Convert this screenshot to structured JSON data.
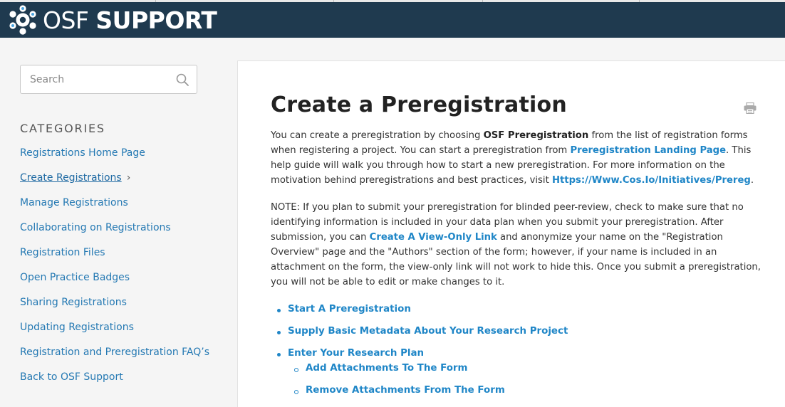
{
  "header": {
    "logo_osf": "OSF",
    "logo_support": "SUPPORT"
  },
  "sidebar": {
    "search_placeholder": "Search",
    "categories_title": "CATEGORIES",
    "items": [
      {
        "label": "Registrations Home Page"
      },
      {
        "label": "Create Registrations",
        "active": true
      },
      {
        "label": "Manage Registrations"
      },
      {
        "label": "Collaborating on Registrations"
      },
      {
        "label": "Registration Files"
      },
      {
        "label": "Open Practice Badges"
      },
      {
        "label": "Sharing Registrations"
      },
      {
        "label": "Updating Registrations"
      },
      {
        "label": "Registration and Preregistration FAQ’s"
      },
      {
        "label": "Back to OSF Support"
      }
    ]
  },
  "article": {
    "title": "Create a Preregistration",
    "p1": {
      "t1": "You can create a preregistration by choosing ",
      "b1": "OSF Preregistration",
      "t2": " from the list of registration forms when registering a project. You can start a preregistration from ",
      "link1": "Preregistration Landing Page",
      "t3": ". This help guide will walk you through how to start a new preregistration. For more information on the motivation behind preregistrations and best practices, visit ",
      "link2": "Https://Www.Cos.Io/Initiatives/Prereg",
      "t4": "."
    },
    "p2": {
      "t1": "NOTE: If you plan to submit your preregistration for blinded peer-review, check to make sure that no identifying information is included in your data plan when you submit your preregistration. After submission, you can ",
      "link1": "Create A View-Only Link",
      "t2": " and anonymize your name on the \"Registration Overview\" page and the \"Authors\" section of the form; however, if your name is included in an attachment on the form, the view-only link will not work to hide this. Once you submit a preregistration, you will not be able to edit or make changes to it."
    },
    "toc": [
      "Start A Preregistration",
      "Supply Basic Metadata About Your Research Project",
      "Enter Your Research Plan"
    ],
    "toc_sub": [
      "Add Attachments To The Form",
      "Remove Attachments From The Form"
    ]
  }
}
